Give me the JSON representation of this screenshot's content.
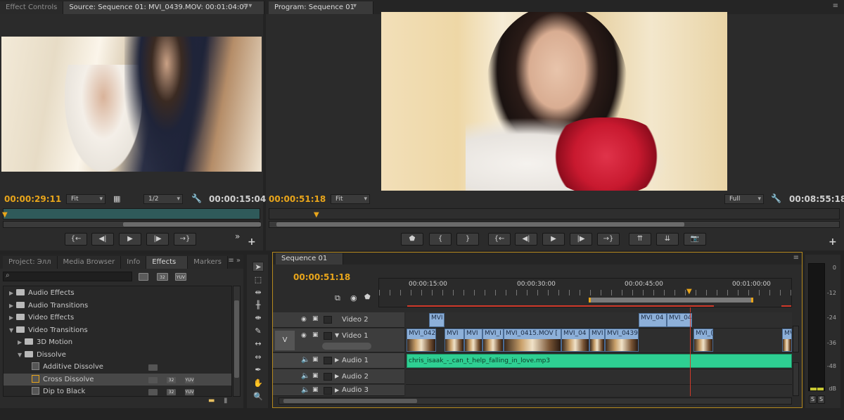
{
  "source_panel": {
    "tabs": [
      {
        "label": "Effect Controls"
      },
      {
        "label": "Source: Sequence 01: MVI_0439.MOV: 00:01:04:07"
      }
    ],
    "timecode_current": "00:00:29:11",
    "fit_label": "Fit",
    "resolution_label": "1/2",
    "timecode_duration": "00:00:15:04"
  },
  "program_panel": {
    "tab": "Program: Sequence 01",
    "timecode_current": "00:00:51:18",
    "fit_label": "Fit",
    "resolution_label": "Full",
    "timecode_duration": "00:08:55:18"
  },
  "project_panel": {
    "tabs": [
      {
        "label": "Project: Элл"
      },
      {
        "label": "Media Browser"
      },
      {
        "label": "Info"
      },
      {
        "label": "Effects"
      },
      {
        "label": "Markers"
      }
    ],
    "filter_badges": [
      "32",
      "YUV"
    ],
    "tree": [
      {
        "label": "Audio Effects",
        "level": 0,
        "type": "folder",
        "expanded": false
      },
      {
        "label": "Audio Transitions",
        "level": 0,
        "type": "folder",
        "expanded": false
      },
      {
        "label": "Video Effects",
        "level": 0,
        "type": "folder",
        "expanded": false
      },
      {
        "label": "Video Transitions",
        "level": 0,
        "type": "folder",
        "expanded": true
      },
      {
        "label": "3D Motion",
        "level": 1,
        "type": "folder",
        "expanded": false
      },
      {
        "label": "Dissolve",
        "level": 1,
        "type": "folder",
        "expanded": true
      },
      {
        "label": "Additive Dissolve",
        "level": 2,
        "type": "effect"
      },
      {
        "label": "Cross Dissolve",
        "level": 2,
        "type": "effect",
        "selected": true
      },
      {
        "label": "Dip to Black",
        "level": 2,
        "type": "effect"
      }
    ]
  },
  "timeline": {
    "tab": "Sequence 01",
    "timecode": "00:00:51:18",
    "ruler_labels": [
      "00:00:15:00",
      "00:00:30:00",
      "00:00:45:00",
      "00:01:00:00"
    ],
    "track_target": "V",
    "tracks": [
      {
        "name": "Video 2"
      },
      {
        "name": "Video 1"
      },
      {
        "name": "Audio 1"
      },
      {
        "name": "Audio 2"
      },
      {
        "name": "Audio 3"
      }
    ],
    "video2_clips": [
      "MVI",
      "MVI_04",
      "MVI_04"
    ],
    "video1_clips": [
      "MVI_042",
      "MVI",
      "MVI",
      "MVI_I",
      "MVI_0415.MOV [",
      "MVI_04",
      "MVI",
      "MVI_0439",
      "MVI_(",
      "MV"
    ],
    "audio1_clip": "chris_isaak_-_can_t_help_falling_in_love.mp3"
  },
  "audio_meter": {
    "scale": [
      "0",
      "-12",
      "-24",
      "-36",
      "-48",
      "dB"
    ],
    "solo_labels": [
      "S",
      "S"
    ]
  },
  "colors": {
    "timecode": "#e8a51b",
    "video_clip": "#8db0d9",
    "audio_clip": "#2ecf92",
    "playhead": "#d03a2a"
  }
}
